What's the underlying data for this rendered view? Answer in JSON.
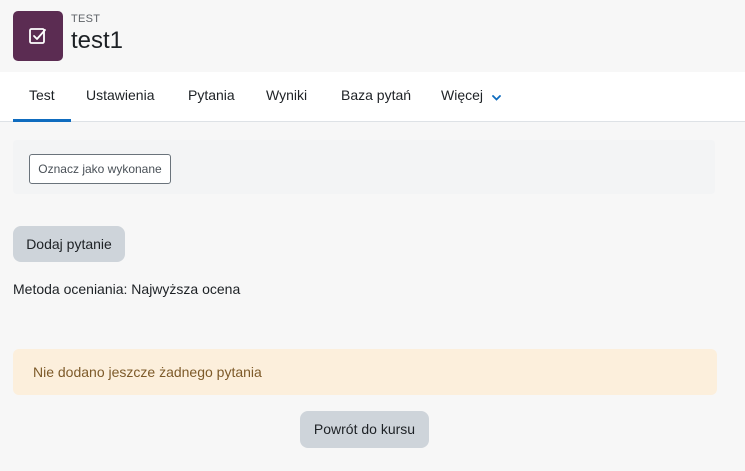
{
  "header": {
    "module_type": "TEST",
    "title": "test1",
    "icon": "quiz-checkbox-icon",
    "icon_color": "#5b2c52"
  },
  "nav": {
    "tabs": [
      {
        "label": "Test",
        "active": true
      },
      {
        "label": "Ustawienia"
      },
      {
        "label": "Pytania"
      },
      {
        "label": "Wyniki"
      },
      {
        "label": "Baza pytań"
      },
      {
        "label": "Więcej"
      }
    ],
    "accent": "#0f6cbf"
  },
  "completion": {
    "button_label": "Oznacz jako wykonane"
  },
  "actions": {
    "add_question_label": "Dodaj pytanie",
    "back_label": "Powrót do kursu"
  },
  "grading": {
    "text": "Metoda oceniania: Najwyższa ocena"
  },
  "alert": {
    "text": "Nie dodano jeszcze żadnego pytania"
  }
}
